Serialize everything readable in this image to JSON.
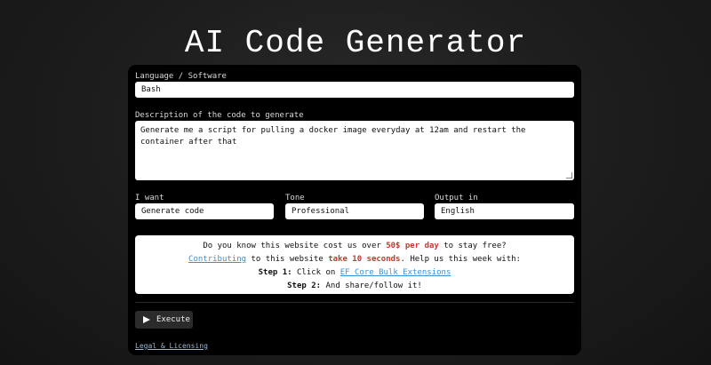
{
  "page": {
    "title": "AI Code Generator"
  },
  "form": {
    "language_label": "Language / Software",
    "language_value": "Bash",
    "description_label": "Description of the code to generate",
    "description_value": "Generate me a script for pulling a docker image everyday at 12am and restart the container after that",
    "want_label": "I want",
    "want_value": "Generate code",
    "tone_label": "Tone",
    "tone_value": "Professional",
    "output_label": "Output in",
    "output_value": "English"
  },
  "notice": {
    "line1_prefix": "Do you know this website cost us over ",
    "line1_highlight": "50$ per day",
    "line1_suffix": " to stay free?",
    "line2_link": "Contributing",
    "line2_middle": " to this website ",
    "line2_highlight": "take 10 seconds",
    "line2_suffix": ". Help us this week with:",
    "step1_label": "Step 1:",
    "step1_text": " Click on ",
    "step1_link": "EF Core Bulk Extensions",
    "step2_label": "Step 2:",
    "step2_text": " And share/follow it!",
    "highlight_color": "#c0392b",
    "link_color": "#3a8fd6"
  },
  "actions": {
    "execute_label": "Execute",
    "execute_icon": "play-icon"
  },
  "footer": {
    "legal_link": "Legal & Licensing"
  }
}
